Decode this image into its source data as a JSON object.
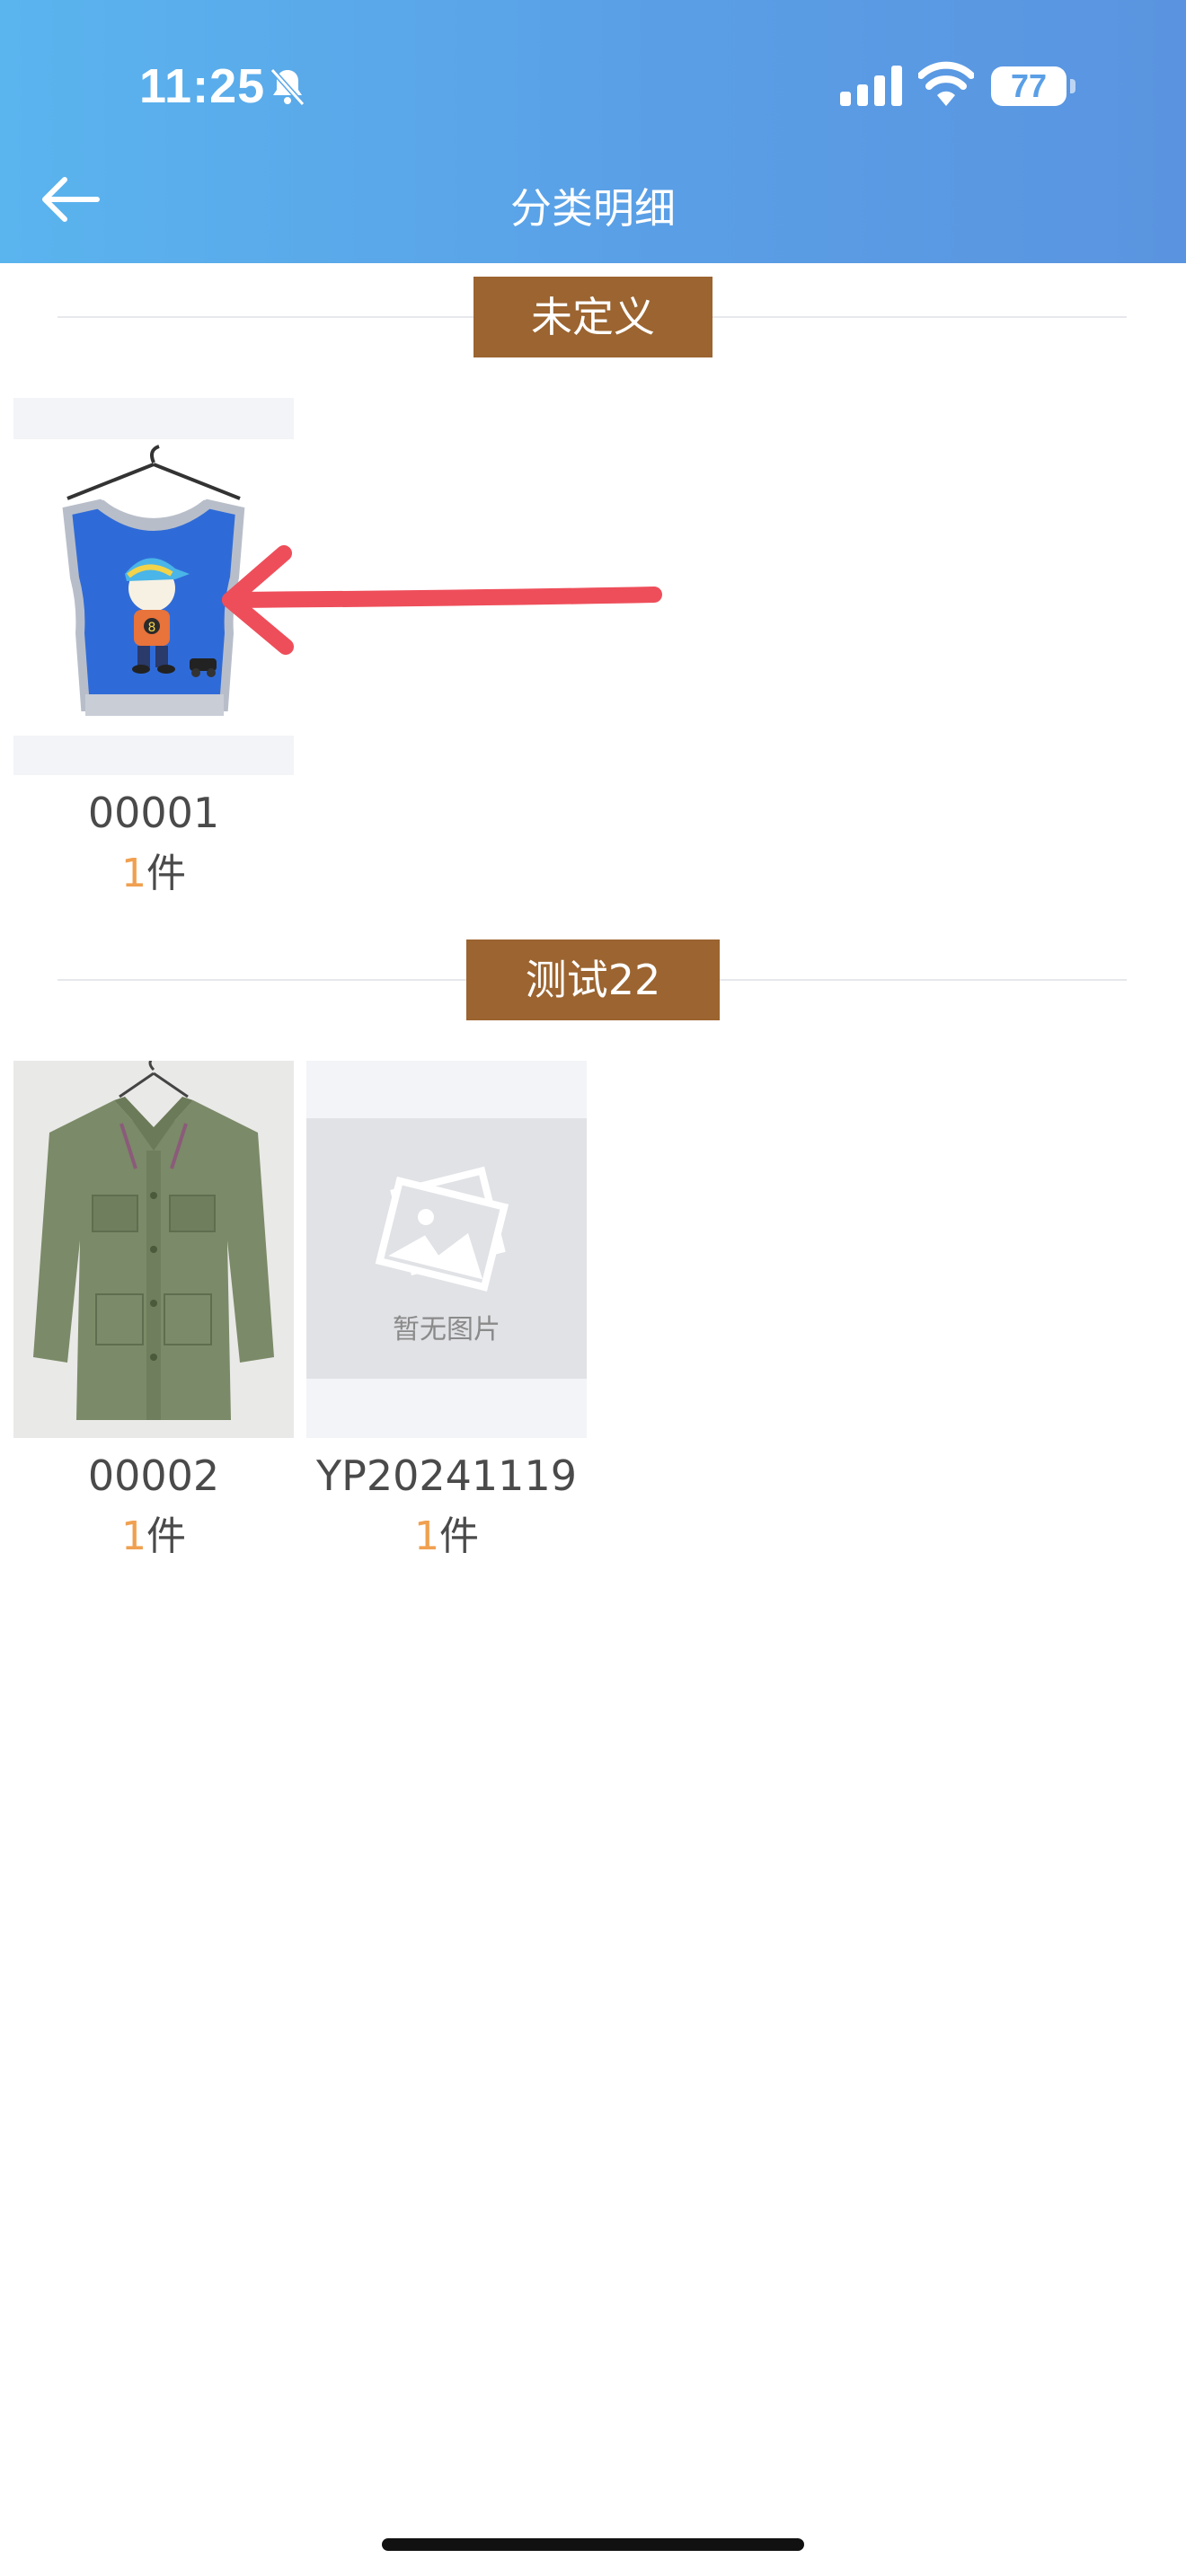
{
  "status_bar": {
    "time": "11:25",
    "battery": "77"
  },
  "nav": {
    "title": "分类明细"
  },
  "sections": [
    {
      "label": "未定义",
      "items": [
        {
          "code": "00001",
          "qty": "1",
          "unit": "件",
          "image": "vest-photo"
        }
      ]
    },
    {
      "label": "测试22",
      "items": [
        {
          "code": "00002",
          "qty": "1",
          "unit": "件",
          "image": "jacket-photo"
        },
        {
          "code": "YP20241119",
          "qty": "1",
          "unit": "件",
          "image": "no-image",
          "placeholder_text": "暂无图片"
        }
      ]
    }
  ],
  "colors": {
    "header_start": "#5ab4ee",
    "header_end": "#5a94e0",
    "section_label_bg": "#9b6430",
    "qty_accent": "#f0a050"
  }
}
